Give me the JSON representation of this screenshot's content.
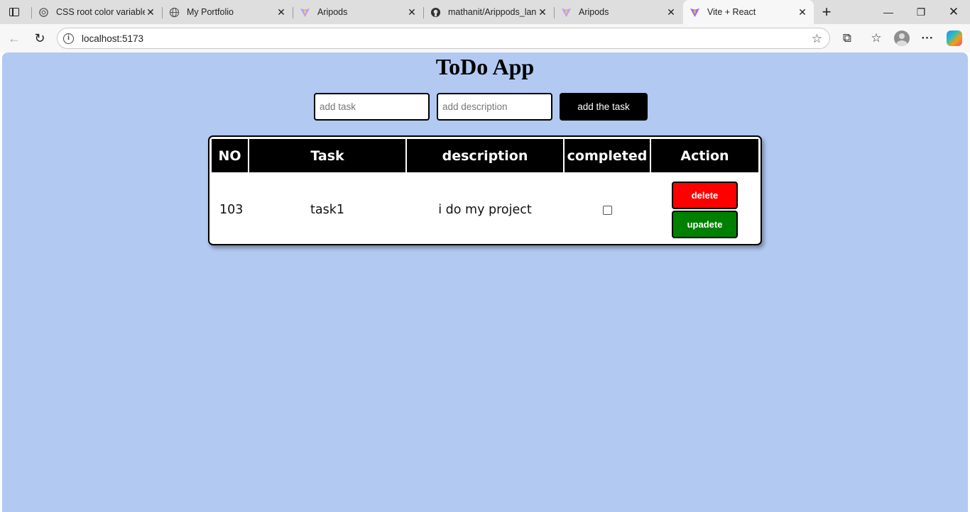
{
  "browser": {
    "tabs": [
      {
        "title": "CSS root color variable",
        "favicon": "openai-icon"
      },
      {
        "title": "My Portfolio",
        "favicon": "globe-icon"
      },
      {
        "title": "Aripods",
        "favicon": "vite-icon"
      },
      {
        "title": "mathanit/Arippods_lan",
        "favicon": "github-icon"
      },
      {
        "title": "Aripods",
        "favicon": "vite-icon"
      },
      {
        "title": "Vite + React",
        "favicon": "vite-icon",
        "active": true
      }
    ],
    "url": "localhost:5173"
  },
  "app": {
    "title": "ToDo App",
    "task_placeholder": "add task",
    "description_placeholder": "add description",
    "add_button": "add the task",
    "columns": {
      "no": "NO",
      "task": "Task",
      "description": "description",
      "completed": "completed",
      "action": "Action"
    },
    "rows": [
      {
        "no": "103",
        "task": "task1",
        "description": "i do my project",
        "completed": false,
        "delete_label": "delete",
        "update_label": "upadete"
      }
    ]
  },
  "colors": {
    "page_background": "#b2c9f2",
    "delete_button": "#ff0000",
    "update_button": "#008000",
    "header_background": "#000000"
  }
}
